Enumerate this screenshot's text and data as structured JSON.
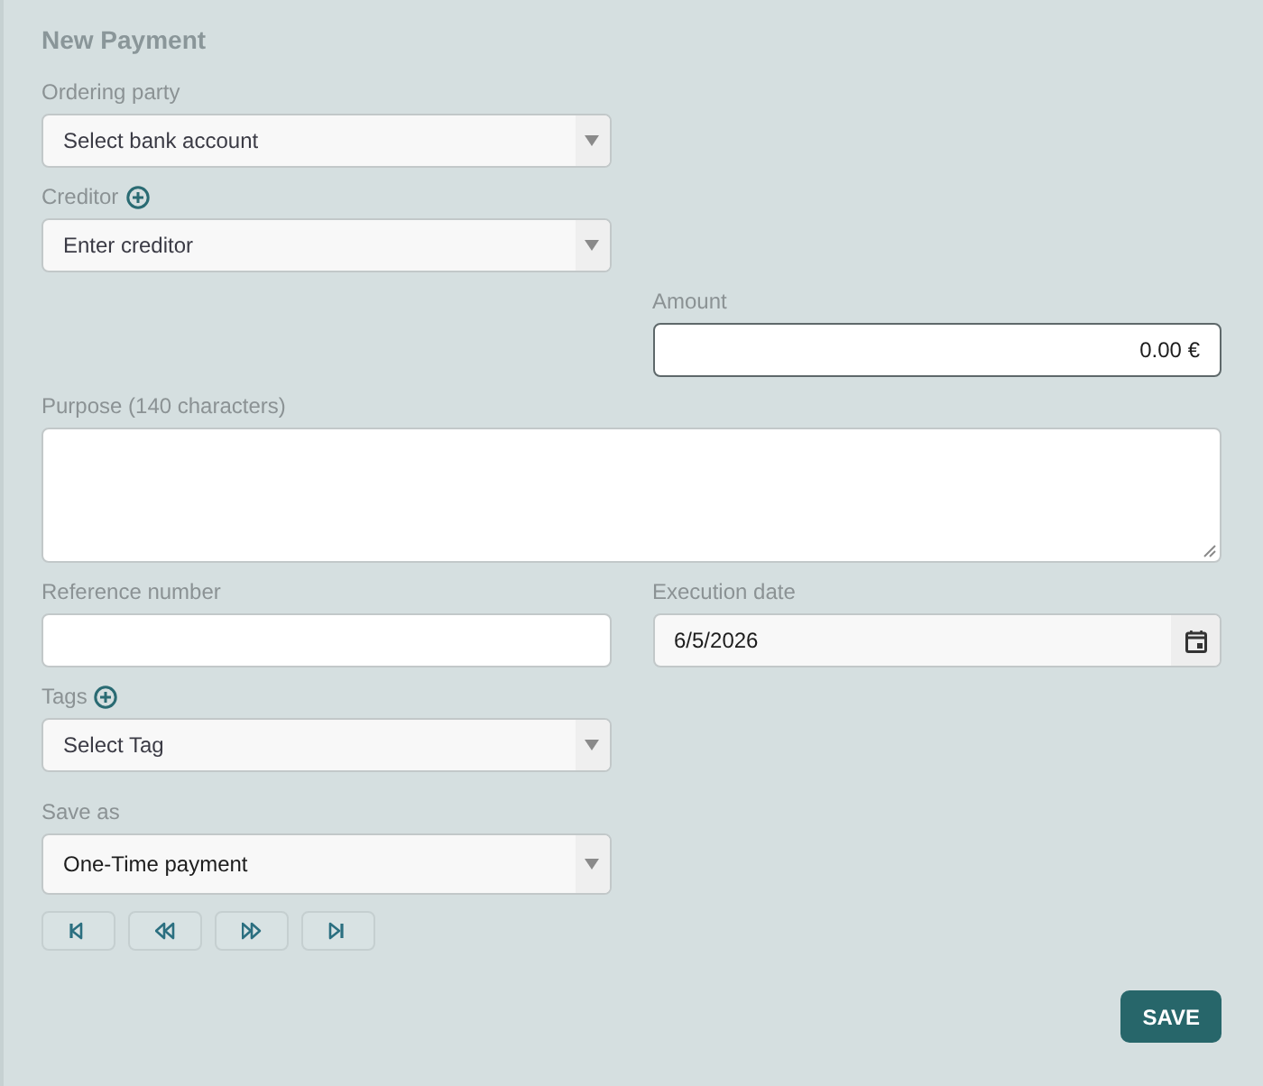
{
  "form": {
    "title": "New Payment",
    "rows": [
      {
        "left": {
          "kind": "select",
          "label": "Ordering party",
          "addable": false,
          "focused": false,
          "placeholder": "Select bank account"
        }
      },
      {
        "left": {
          "kind": "select",
          "label": "Creditor",
          "addable": true,
          "focused": false,
          "placeholder": "Enter creditor"
        }
      },
      {
        "right": {
          "kind": "amount",
          "label": "Amount",
          "addable": false,
          "focused": true,
          "value": "0.00 €"
        }
      },
      {
        "full": {
          "kind": "textarea",
          "label": "Purpose (140 characters)",
          "addable": false,
          "focused": false
        }
      },
      {
        "left": {
          "kind": "text",
          "label": "Reference number",
          "addable": false,
          "focused": false
        },
        "right": {
          "kind": "date",
          "label": "Execution date",
          "addable": false,
          "focused": false,
          "value": "6/5/2026"
        }
      },
      {
        "left": {
          "kind": "select",
          "label": "Tags",
          "addable": true,
          "focused": false,
          "placeholder": "Select Tag"
        }
      }
    ],
    "save_as": {
      "kind": "select",
      "label": "Save as",
      "addable": false,
      "focused": false,
      "value": "One-Time payment"
    },
    "nav_buttons": [
      {
        "kind": "first"
      },
      {
        "kind": "previous"
      },
      {
        "kind": "next"
      },
      {
        "kind": "last"
      }
    ],
    "save_button": {
      "label": "SAVE"
    }
  }
}
